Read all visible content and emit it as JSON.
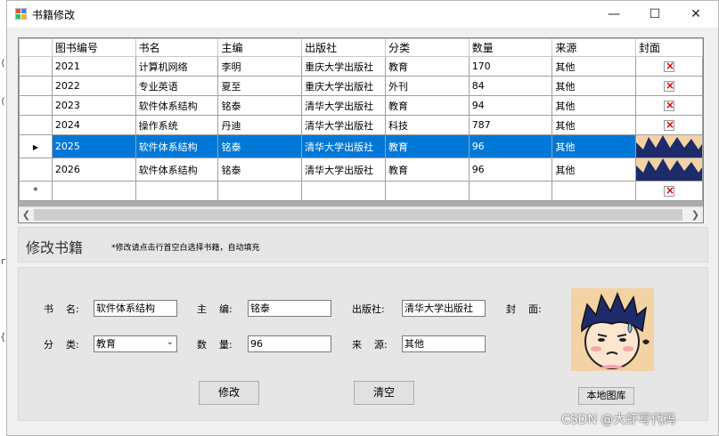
{
  "window": {
    "title": "书籍修改"
  },
  "grid": {
    "columns": [
      "图书编号",
      "书名",
      "主编",
      "出版社",
      "分类",
      "数量",
      "来源",
      "封面"
    ],
    "rows": [
      {
        "id": "2021",
        "name": "计算机网络",
        "editor": "李明",
        "publisher": "重庆大学出版社",
        "category": "教育",
        "qty": "170",
        "source": "其他"
      },
      {
        "id": "2022",
        "name": "专业英语",
        "editor": "夏至",
        "publisher": "重庆大学出版社",
        "category": "外刊",
        "qty": "84",
        "source": "其他"
      },
      {
        "id": "2023",
        "name": "软件体系结构",
        "editor": "铭泰",
        "publisher": "清华大学出版社",
        "category": "教育",
        "qty": "94",
        "source": "其他"
      },
      {
        "id": "2024",
        "name": "操作系统",
        "editor": "丹迪",
        "publisher": "清华大学出版社",
        "category": "科技",
        "qty": "787",
        "source": "其他"
      },
      {
        "id": "2025",
        "name": "软件体系结构",
        "editor": "铭泰",
        "publisher": "清华大学出版社",
        "category": "教育",
        "qty": "96",
        "source": "其他"
      },
      {
        "id": "2026",
        "name": "软件体系结构",
        "editor": "铭泰",
        "publisher": "清华大学出版社",
        "category": "教育",
        "qty": "96",
        "source": "其他"
      }
    ],
    "selected_row_index": 4,
    "new_row_marker": "*",
    "current_row_marker": "▶"
  },
  "section": {
    "heading": "修改书籍",
    "hint": "*修改请点击行首空白选择书籍，自动填充"
  },
  "form": {
    "book_name_label": "书    名:",
    "book_name_value": "软件体系结构",
    "editor_label": "主    编:",
    "editor_value": "铭泰",
    "publisher_label": "出版社:",
    "publisher_value": "清华大学出版社",
    "cover_label": "封    面:",
    "category_label": "分    类:",
    "category_value": "教育",
    "qty_label": "数    量:",
    "qty_value": "96",
    "source_label": "来    源:",
    "source_value": "其他",
    "modify_button": "修改",
    "clear_button": "清空",
    "local_gallery_button": "本地图库"
  },
  "watermark": "CSDN @大虾写代码",
  "bg_marks": [
    "(",
    "(",
    "r",
    "{"
  ]
}
